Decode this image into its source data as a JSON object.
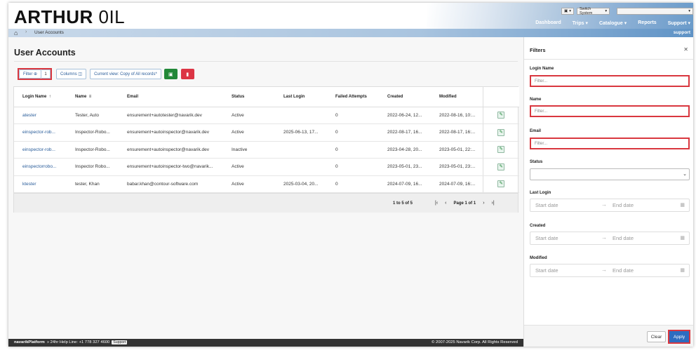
{
  "brand": {
    "bold": "ARTHUR",
    "regular": " 0IL"
  },
  "switcher": {
    "box_label": "Switch System"
  },
  "topnav": [
    "Dashboard",
    "Trips ▾",
    "Catalogue ▾",
    "Reports",
    "Support ▾"
  ],
  "breadcrumb": {
    "current": "User Accounts",
    "user": "support"
  },
  "page_title": "User Accounts",
  "toolbar": {
    "filter_label": "Filter",
    "filter_count": "1",
    "columns_label": "Columns",
    "view_label": "Current view: Copy of All records*"
  },
  "table": {
    "headers": [
      "Login Name",
      "Name",
      "Email",
      "Status",
      "Last Login",
      "Failed Attempts",
      "Created",
      "Modified"
    ],
    "rows": [
      [
        "atester",
        "Tester, Auto",
        "ensurement+autotester@navarik.dev",
        "Active",
        "",
        "0",
        "2022-06-24, 12...",
        "2022-08-16, 10:..."
      ],
      [
        "einspector-rob...",
        "Inspector-Robo...",
        "ensurement+autoinspector@navarik.dev",
        "Active",
        "2025-06-13, 17...",
        "0",
        "2022-08-17, 16...",
        "2022-08-17, 16:..."
      ],
      [
        "einspector-rob...",
        "Inspector-Robo...",
        "ensurement+autoinspector@navarik.dev",
        "Inactive",
        "",
        "0",
        "2023-04-28, 20...",
        "2023-05-01, 22:..."
      ],
      [
        "einspectorrobo...",
        "Inspector Robo...",
        "ensurement+autoinspector-two@navarik...",
        "Active",
        "",
        "0",
        "2023-05-01, 23...",
        "2023-05-01, 23:..."
      ],
      [
        "ktester",
        "tester, Khan",
        "babar.khan@contour-software.com",
        "Active",
        "2025-03-04, 20...",
        "0",
        "2024-07-09, 16...",
        "2024-07-09, 16:..."
      ]
    ],
    "pagination": {
      "count": "1 to 5 of 5",
      "page": "Page 1 of 1"
    }
  },
  "footer": {
    "platform": "navarikPlatform",
    "helpline": "» 24hr Help Line: +1 778 327 4600",
    "support_btn": "Support",
    "copyright": "© 2007-2025 Navarik Corp. All Rights Reserved"
  },
  "filters": {
    "title": "Filters",
    "login_name": {
      "label": "Login Name",
      "placeholder": "Filter..."
    },
    "name": {
      "label": "Name",
      "placeholder": "Filter..."
    },
    "email": {
      "label": "Email",
      "placeholder": "Filter..."
    },
    "status": {
      "label": "Status"
    },
    "last_login": {
      "label": "Last Login",
      "start": "Start date",
      "end": "End date"
    },
    "created": {
      "label": "Created",
      "start": "Start date",
      "end": "End date"
    },
    "modified": {
      "label": "Modified",
      "start": "Start date",
      "end": "End date"
    },
    "clear_label": "Clear",
    "apply_label": "Apply"
  }
}
